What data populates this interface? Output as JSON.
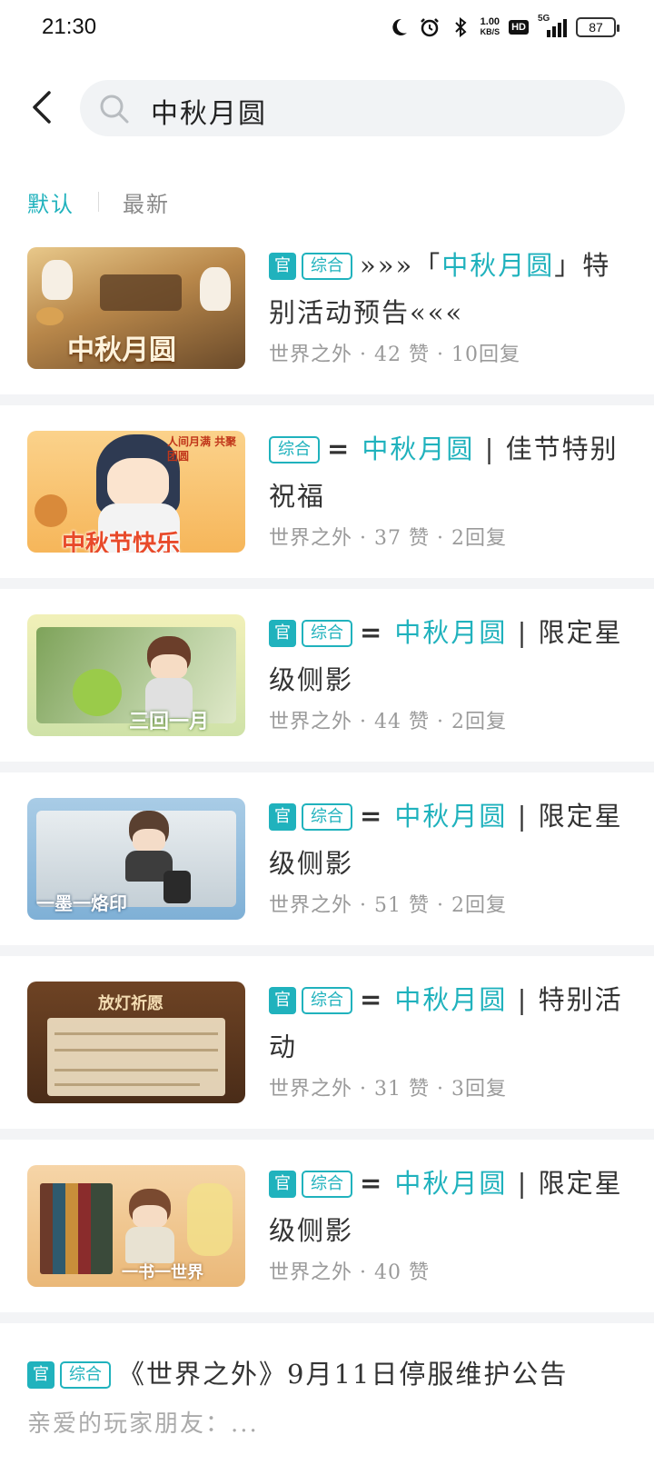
{
  "status_bar": {
    "time": "21:30",
    "speed_value": "1.00",
    "speed_unit": "KB/S",
    "hd_label": "HD",
    "network_label": "5G",
    "battery": "87",
    "icons": [
      "moon-icon",
      "alarm-icon",
      "bluetooth-icon",
      "signal-icon",
      "battery-icon"
    ]
  },
  "search": {
    "query": "中秋月圆"
  },
  "sort_tabs": [
    {
      "label": "默认",
      "active": true
    },
    {
      "label": "最新",
      "active": false
    }
  ],
  "colors": {
    "accent": "#20b2bd",
    "meta": "#9a9a9a",
    "separator": "#f3f4f6"
  },
  "posts": [
    {
      "official_tag": "官",
      "category_tag": "综合",
      "title_prefix": "»»»「",
      "title_highlight": "中秋月圆",
      "title_suffix": "」特别活动预告«««",
      "meta": "世界之外 · 42 赞 · 10回复",
      "thumb_caption": "中秋月圆"
    },
    {
      "official_tag": "",
      "category_tag": "综合",
      "title_prefix": "= ",
      "title_highlight": "中秋月圆",
      "title_suffix": " | 佳节特别祝福",
      "meta": "世界之外 · 37 赞 · 2回复",
      "thumb_caption": "中秋节快乐",
      "thumb_corner": "人间月满 共聚团圆"
    },
    {
      "official_tag": "官",
      "category_tag": "综合",
      "title_prefix": "= ",
      "title_highlight": "中秋月圆",
      "title_suffix": " | 限定星级侧影",
      "meta": "世界之外 · 44 赞 · 2回复",
      "thumb_caption": "三回一月"
    },
    {
      "official_tag": "官",
      "category_tag": "综合",
      "title_prefix": "= ",
      "title_highlight": "中秋月圆",
      "title_suffix": " | 限定星级侧影",
      "meta": "世界之外 · 51 赞 · 2回复",
      "thumb_caption": "一墨一烙印"
    },
    {
      "official_tag": "官",
      "category_tag": "综合",
      "title_prefix": "= ",
      "title_highlight": "中秋月圆",
      "title_suffix": " | 特别活动",
      "meta": "世界之外 · 31 赞 · 3回复",
      "thumb_caption": "放灯祈愿"
    },
    {
      "official_tag": "官",
      "category_tag": "综合",
      "title_prefix": "= ",
      "title_highlight": "中秋月圆",
      "title_suffix": " | 限定星级侧影",
      "meta": "世界之外 · 40 赞",
      "thumb_caption": "一书一世界"
    }
  ],
  "last_post": {
    "official_tag": "官",
    "category_tag": "综合",
    "title": "《世界之外》9月11日停服维护公告",
    "preview": "亲爱的玩家朋友：..."
  }
}
